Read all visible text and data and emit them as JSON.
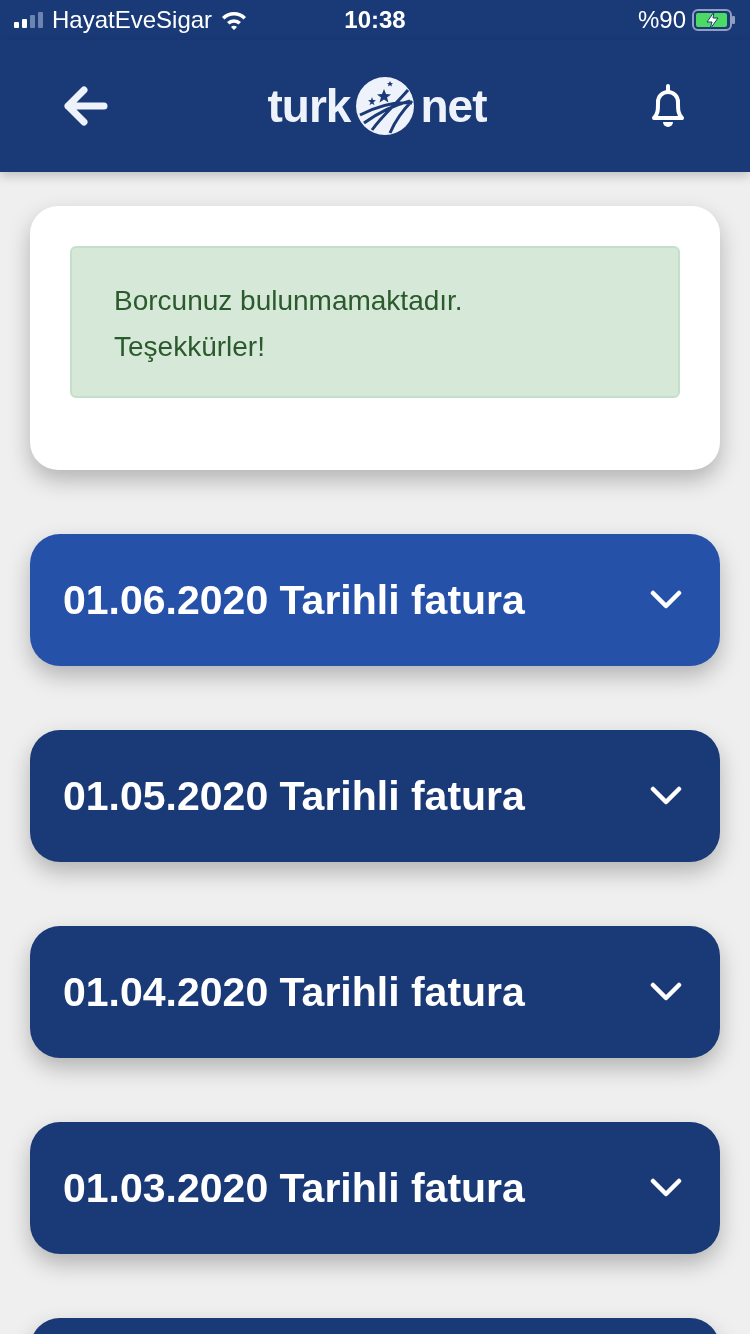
{
  "status_bar": {
    "carrier": "HayatEveSigar",
    "time": "10:38",
    "battery": "%90"
  },
  "header": {
    "logo": {
      "left": "turk",
      "right": "net"
    }
  },
  "notice": {
    "lines": [
      "Borcunuz bulunmamaktadır.",
      "Teşekkürler!"
    ]
  },
  "invoices": [
    {
      "label": "01.06.2020 Tarihli fatura",
      "selected": true
    },
    {
      "label": "01.05.2020 Tarihli fatura",
      "selected": false
    },
    {
      "label": "01.04.2020 Tarihli fatura",
      "selected": false
    },
    {
      "label": "01.03.2020 Tarihli fatura",
      "selected": false
    }
  ]
}
